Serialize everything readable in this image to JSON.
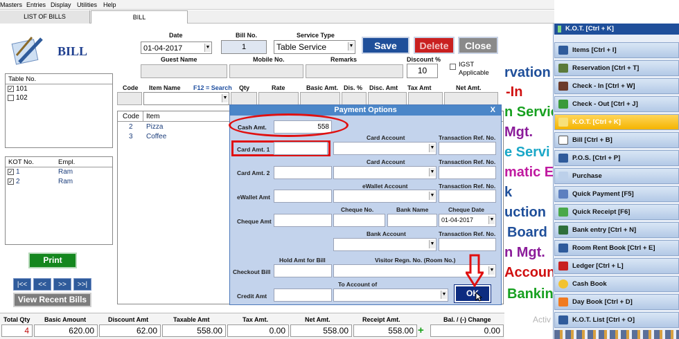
{
  "menu": [
    "Masters",
    "Entries",
    "Display",
    "Utilities",
    "Help"
  ],
  "tabs": {
    "list": "LIST OF BILLS",
    "bill": "BILL"
  },
  "title": "BILL",
  "date": {
    "label": "Date",
    "value": "01-04-2017"
  },
  "billno": {
    "label": "Bill No.",
    "value": "1"
  },
  "service": {
    "label": "Service Type",
    "value": "Table Service"
  },
  "buttons": {
    "save": "Save",
    "delete": "Delete",
    "close": "Close",
    "print": "Print",
    "view_recent": "View Recent Bills",
    "ok": "OK"
  },
  "guest_label": "Guest Name",
  "mobile_label": "Mobile No.",
  "remarks_label": "Remarks",
  "discount": {
    "label": "Discount %",
    "value": "10"
  },
  "igst_label": "IGST Applicable",
  "table_no": {
    "header": "Table No.",
    "items": [
      "101",
      "102"
    ]
  },
  "kot": {
    "h1": "KOT No.",
    "h2": "Empl.",
    "rows": [
      {
        "no": "1",
        "emp": "Ram"
      },
      {
        "no": "2",
        "emp": "Ram"
      }
    ]
  },
  "grid": {
    "code": "Code",
    "item": "Item Name",
    "search": "F12 = Search",
    "qty": "Qty",
    "rate": "Rate",
    "basic": "Basic Amt.",
    "dis": "Dis. %",
    "disc": "Disc. Amt",
    "tax": "Tax Amt",
    "net": "Net Amt."
  },
  "items": {
    "h_code": "Code",
    "h_item": "Item",
    "rows": [
      {
        "code": "2",
        "item": "Pizza"
      },
      {
        "code": "3",
        "item": "Coffee"
      }
    ]
  },
  "nav": [
    "|<<",
    "<<",
    ">>",
    ">>|"
  ],
  "totals": {
    "tq_l": "Total Qty",
    "tq": "4",
    "ba_l": "Basic Amount",
    "ba": "620.00",
    "da_l": "Discount Amt",
    "da": "62.00",
    "ta_l": "Taxable Amt",
    "ta": "558.00",
    "tx_l": "Tax Amt.",
    "tx": "0.00",
    "na_l": "Net Amt.",
    "na": "558.00",
    "ra_l": "Receipt Amt.",
    "ra": "558.00",
    "bal_l": "Bal. / (-) Change",
    "bal": "0.00"
  },
  "payment": {
    "title": "Payment Options",
    "close": "X",
    "cash_label": "Cash Amt.",
    "cash": "558",
    "card1": "Card Amt. 1",
    "card2": "Card Amt. 2",
    "card_account": "Card Account",
    "txn": "Transaction Ref. No.",
    "ewallet": "eWallet Amt",
    "ewallet_account": "eWallet Account",
    "cheque": "Cheque Amt",
    "cheque_no": "Cheque No.",
    "bank_name": "Bank Name",
    "cheque_date_label": "Cheque Date",
    "cheque_date": "01-04-2017",
    "bank_account": "Bank Account",
    "hold": "Hold Amt for Bill",
    "visitor": "Visitor Regn. No. (Room No.)",
    "checkout": "Checkout Bill",
    "to_account": "To Account of",
    "credit": "Credit Amt"
  },
  "bg_text": [
    "rvation",
    "-In",
    "n Servic",
    "Mgt.",
    "e Servi",
    "matic E",
    "k",
    "uction",
    "Board",
    "n Mgt.",
    "Accoun",
    "Bankin"
  ],
  "watermark": "Activ",
  "right_header": "K.O.T. [Ctrl + K]",
  "right_menu": [
    "Items [Ctrl + I]",
    "Reservation [Ctrl + T]",
    "Check - In [Ctrl + W]",
    "Check - Out [Ctrl + J]",
    "K.O.T. [Ctrl + K]",
    "Bill [Ctrl + B]",
    "P.O.S. [Ctrl + P]",
    "Purchase",
    "Quick Payment [F5]",
    "Quick Receipt [F6]",
    "Bank entry [Ctrl + N]",
    "Room Rent Book [Ctrl + E]",
    "Ledger [Ctrl + L]",
    "Cash Book",
    "Day Book [Ctrl + D]",
    "K.O.T. List [Ctrl + O]"
  ],
  "colors": {
    "accent": "#1f4f9a",
    "active": "#f4b400",
    "annotation": "#e01010"
  }
}
